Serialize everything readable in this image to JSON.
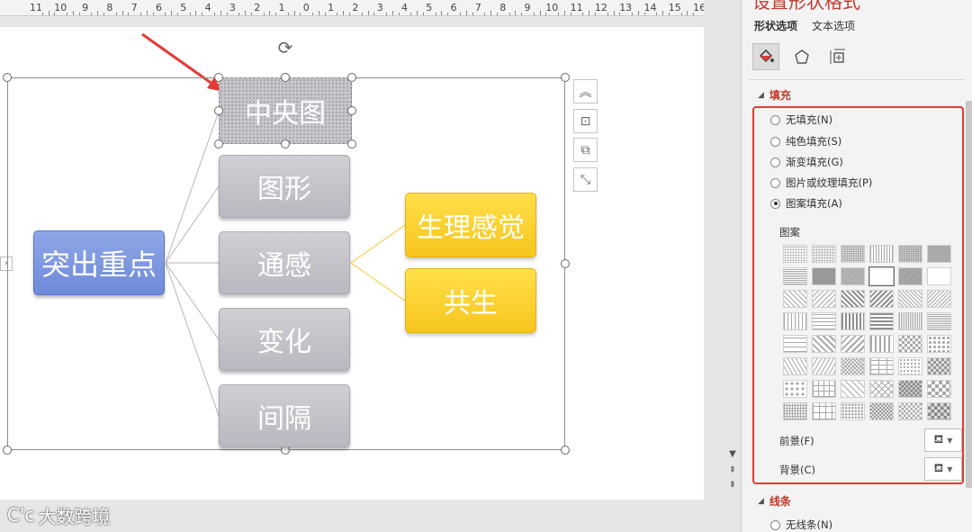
{
  "ruler": {
    "labels": [
      "11",
      "10",
      "9",
      "8",
      "7",
      "6",
      "5",
      "4",
      "3",
      "2",
      "1",
      "0",
      "1",
      "2",
      "3",
      "4",
      "5",
      "6",
      "7",
      "8",
      "9",
      "10",
      "11",
      "12",
      "13",
      "14",
      "15",
      "16"
    ]
  },
  "mindmap": {
    "center": "突出重点",
    "top": "中央图",
    "branches": [
      "图形",
      "通感",
      "变化",
      "间隔"
    ],
    "sub": [
      "生理感觉",
      "共生"
    ]
  },
  "watermark": {
    "text": "大数跨境",
    "logo": "C'c"
  },
  "pane": {
    "title": "设置形状格式",
    "tabs": [
      "形状选项",
      "文本选项"
    ],
    "icons": [
      "fill-line-icon",
      "effects-pentagon-icon",
      "size-layout-icon"
    ],
    "fill_section": "填充",
    "fill_options": [
      "无填充(N)",
      "纯色填充(S)",
      "渐变填充(G)",
      "图片或纹理填充(P)",
      "图案填充(A)"
    ],
    "selected_option": "图案填充(A)",
    "pattern_label": "图案",
    "foreground_label": "前景(F)",
    "background_label": "背景(C)",
    "line_section": "线条",
    "line_first_option": "无线条(N)"
  },
  "colors": {
    "accent_red": "#e53935",
    "title_red": "#c0392b",
    "node_gray": "#c2c2c8",
    "node_yellow": "#f9cc2a",
    "node_blue": "#7d97df"
  }
}
